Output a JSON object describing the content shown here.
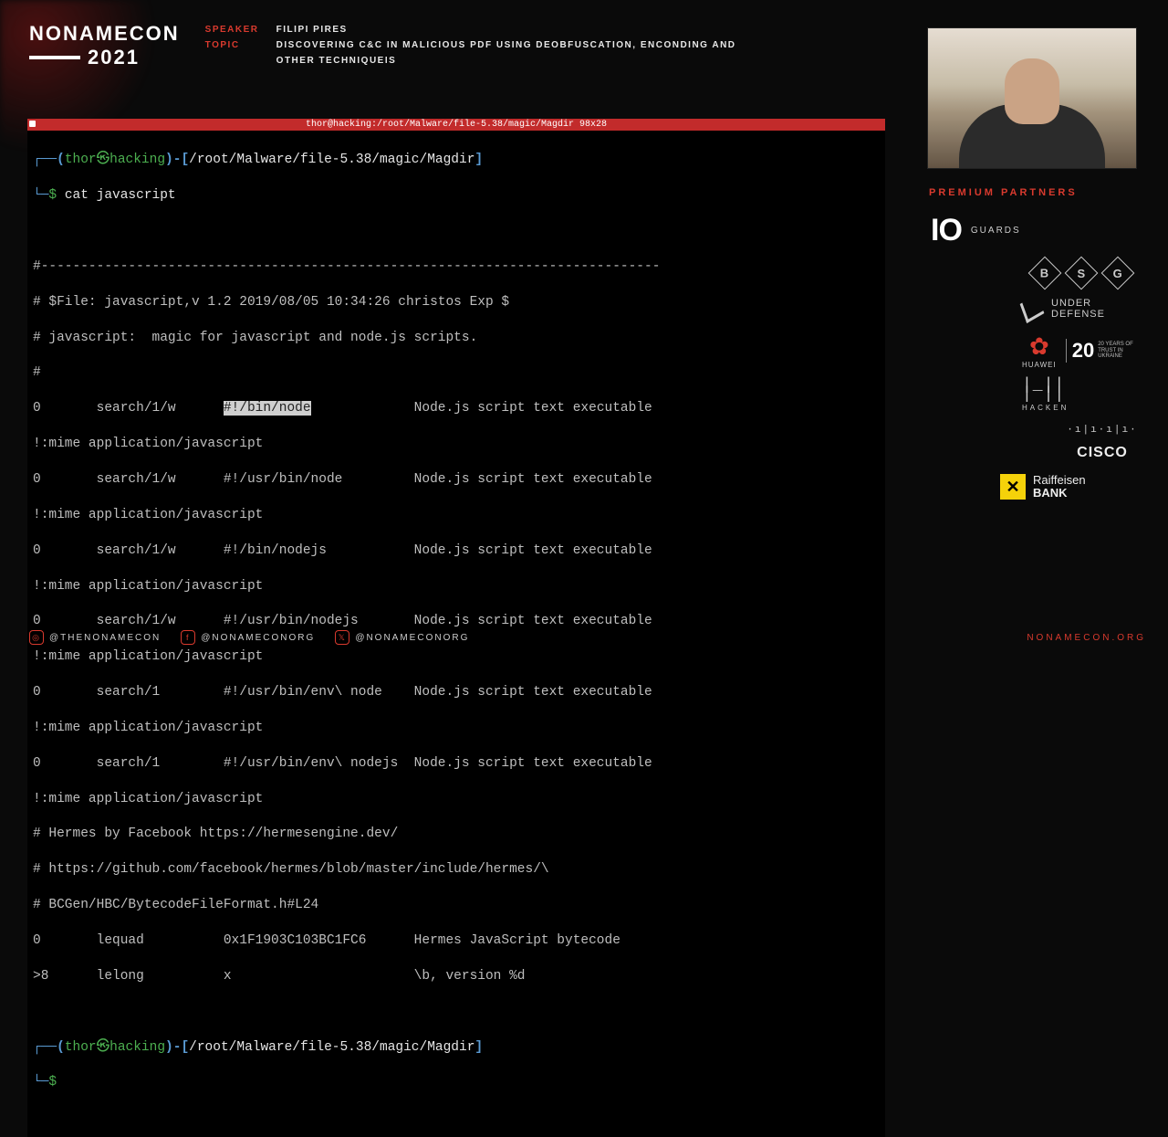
{
  "header": {
    "logo_line1": "NONAMECON",
    "logo_year": "2021",
    "speaker_label": "SPEAKER",
    "speaker_value": "FILIPI PIRES",
    "topic_label": "TOPIC",
    "topic_value": "DISCOVERING C&C IN MALICIOUS PDF USING DEOBFUSCATION, ENCONDING AND OTHER TECHNIQUEIS"
  },
  "terminal": {
    "titlebar": "thor@hacking:/root/Malware/file-5.38/magic/Magdir 98x28",
    "prompt_user": "thor",
    "prompt_host": "hacking",
    "prompt_path": "/root/Malware/file-5.38/magic/Magdir",
    "command": "cat javascript",
    "output_lines": [
      "#------------------------------------------------------------------------------",
      "# $File: javascript,v 1.2 2019/08/05 10:34:26 christos Exp $",
      "# javascript:  magic for javascript and node.js scripts.",
      "#",
      "0       search/1/w      #!/bin/node             Node.js script text executable",
      "!:mime application/javascript",
      "0       search/1/w      #!/usr/bin/node         Node.js script text executable",
      "!:mime application/javascript",
      "0       search/1/w      #!/bin/nodejs           Node.js script text executable",
      "!:mime application/javascript",
      "0       search/1/w      #!/usr/bin/nodejs       Node.js script text executable",
      "!:mime application/javascript",
      "0       search/1        #!/usr/bin/env\\ node    Node.js script text executable",
      "!:mime application/javascript",
      "0       search/1        #!/usr/bin/env\\ nodejs  Node.js script text executable",
      "!:mime application/javascript",
      "# Hermes by Facebook https://hermesengine.dev/",
      "# https://github.com/facebook/hermes/blob/master/include/hermes/\\",
      "# BCGen/HBC/BytecodeFileFormat.h#L24",
      "0       lequad          0x1F1903C103BC1FC6      Hermes JavaScript bytecode",
      ">8      lelong          x                       \\b, version %d"
    ],
    "highlight_text": "#!/bin/node"
  },
  "sidebar": {
    "partners_label": "PREMIUM PARTNERS",
    "partners": {
      "io_name": "IO",
      "io_sub": "GUARDS",
      "bsg": [
        "B",
        "S",
        "G"
      ],
      "under_defense_l1": "UNDER",
      "under_defense_l2": "DEFENSE",
      "huawei_name": "HUAWEI",
      "huawei_20": "20",
      "huawei_tag": "20 YEARS OF TRUST IN UKRAINE",
      "hacken_label": "HACKEN",
      "cisco_label": "CISCO",
      "raiffeisen_l1": "Raiffeisen",
      "raiffeisen_l2": "BANK"
    }
  },
  "footer": {
    "instagram_handle": "@THENONAMECON",
    "facebook_handle": "@NONAMECONORG",
    "x_handle": "@NONAMECONORG",
    "site": "NONAMECON.ORG"
  }
}
